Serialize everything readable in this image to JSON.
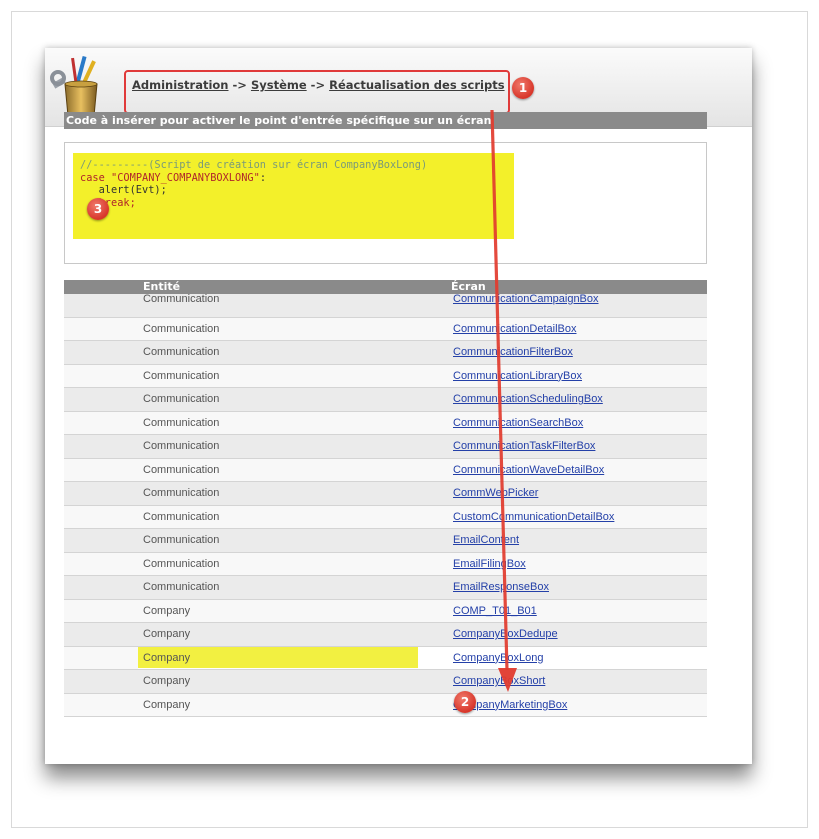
{
  "breadcrumb": {
    "items": [
      "Administration",
      "Système",
      "Réactualisation des scripts"
    ],
    "separator": "->"
  },
  "section_title": "Code à insérer pour activer le point d'entrée spécifique sur un écran",
  "code": {
    "comment": "//---------(Script de création sur écran CompanyBoxLong)",
    "case_kw": "case",
    "case_value": "\"COMPANY_COMPANYBOXLONG\"",
    "case_colon": ":",
    "line3": "   alert(Evt);",
    "line4": "   break;"
  },
  "table": {
    "col_entite": "Entité",
    "col_ecran": "Écran",
    "rows": [
      {
        "entite": "Communication",
        "ecran": "CommunicationCampaignBox"
      },
      {
        "entite": "Communication",
        "ecran": "CommunicationDetailBox"
      },
      {
        "entite": "Communication",
        "ecran": "CommunicationFilterBox"
      },
      {
        "entite": "Communication",
        "ecran": "CommunicationLibraryBox"
      },
      {
        "entite": "Communication",
        "ecran": "CommunicationSchedulingBox"
      },
      {
        "entite": "Communication",
        "ecran": "CommunicationSearchBox"
      },
      {
        "entite": "Communication",
        "ecran": "CommunicationTaskFilterBox"
      },
      {
        "entite": "Communication",
        "ecran": "CommunicationWaveDetailBox"
      },
      {
        "entite": "Communication",
        "ecran": "CommWebPicker"
      },
      {
        "entite": "Communication",
        "ecran": "CustomCommunicationDetailBox"
      },
      {
        "entite": "Communication",
        "ecran": "EmailContent"
      },
      {
        "entite": "Communication",
        "ecran": "EmailFilingBox"
      },
      {
        "entite": "Communication",
        "ecran": "EmailResponseBox"
      },
      {
        "entite": "Company",
        "ecran": "COMP_T01_B01"
      },
      {
        "entite": "Company",
        "ecran": "CompanyBoxDedupe"
      },
      {
        "entite": "Company",
        "ecran": "CompanyBoxLong"
      },
      {
        "entite": "Company",
        "ecran": "CompanyBoxShort"
      },
      {
        "entite": "Company",
        "ecran": "CompanyMarketingBox"
      }
    ]
  },
  "badges": [
    "1",
    "2",
    "3"
  ],
  "colors": {
    "highlight_yellow": "#f3f02a",
    "callout_red": "#e03a3a",
    "link_blue": "#2440a8",
    "header_gray": "#8a8a8a"
  },
  "icons": [
    "tools-cup-icon",
    "arrow-icon"
  ]
}
